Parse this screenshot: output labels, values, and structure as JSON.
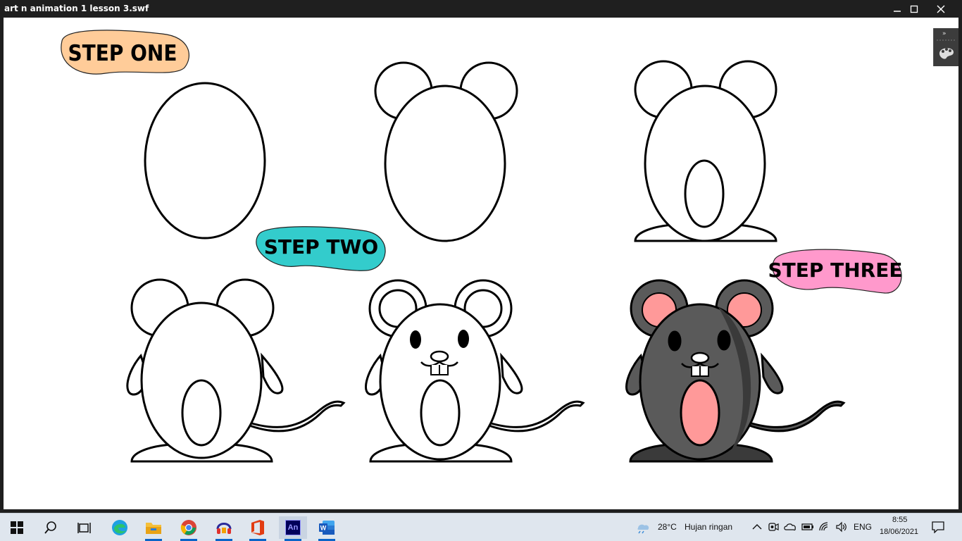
{
  "window": {
    "title": "art n animation 1 lesson 3.swf"
  },
  "banners": {
    "step_one": {
      "label": "STEP ONE",
      "color": "#ffcc99"
    },
    "step_two": {
      "label": "STEP TWO",
      "color": "#33cccc"
    },
    "step_three": {
      "label": "STEP THREE",
      "color": "#ff99cc"
    }
  },
  "colors": {
    "mouse_gray": "#5a5a5a",
    "mouse_dark": "#3a3a3a",
    "mouse_pink": "#ff9999"
  },
  "taskbar": {
    "icons": [
      "windows-start-icon",
      "search-icon",
      "task-view-icon",
      "edge-icon",
      "file-explorer-icon",
      "chrome-icon",
      "audio-app-icon",
      "office-icon",
      "animate-icon",
      "word-icon"
    ],
    "animate_label": "An",
    "weather": {
      "temp": "28°C",
      "condition": "Hujan ringan"
    },
    "language": "ENG",
    "time": "8:55",
    "date": "18/06/2021"
  }
}
